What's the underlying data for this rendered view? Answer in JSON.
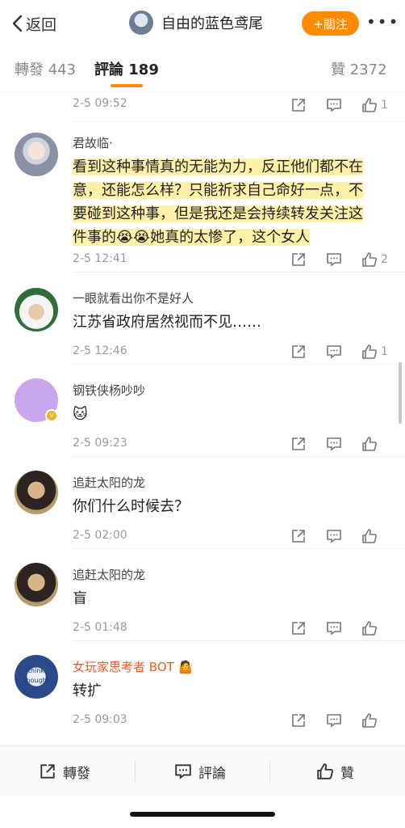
{
  "header": {
    "back_label": "返回",
    "title": "自由的蓝色鸢尾",
    "follow_label": "+關注",
    "more": "•••"
  },
  "tabs": {
    "repost_label": "轉發",
    "repost_count": "443",
    "comment_label": "評論",
    "comment_count": "189",
    "like_label": "贊",
    "like_count": "2372"
  },
  "comments": [
    {
      "time": "2-5 09:52",
      "likes": "1"
    },
    {
      "name": "君故临·",
      "lines": [
        "看到这种事情真的无能为力，反正他们都不在",
        "意，还能怎么样？只能祈求自己命好一点，不",
        "要碰到这种事，但是我还是会持续转发关注这"
      ],
      "line4_a": "件事的",
      "line4_emoji": "😭😭",
      "line4_b": "她真的太惨了，这个女人",
      "time": "2-5 12:41",
      "likes": "2"
    },
    {
      "name": "一眼就看出你不是好人",
      "text": "江苏省政府居然视而不见……",
      "time": "2-5 12:46",
      "likes": "1"
    },
    {
      "name": "钢铁侠杨吵吵",
      "text": "🐱",
      "time": "2-5 09:23",
      "likes": ""
    },
    {
      "name": "追赶太阳的龙",
      "text": "你们什么时候去？",
      "time": "2-5 02:00",
      "likes": ""
    },
    {
      "name": "追赶太阳的龙",
      "text": "盲",
      "time": "2-5 01:48",
      "likes": ""
    },
    {
      "name": "女玩家思考者 BOT",
      "name_emoji": "🤷",
      "avatar_text": "think thought",
      "text": "转扩",
      "time": "2-5 09:03",
      "likes": ""
    }
  ],
  "bottom": {
    "repost_label": "轉發",
    "comment_label": "評論",
    "like_label": "贊"
  },
  "colors": {
    "accent": "#ff8a00",
    "highlight": "#fff1a8",
    "bot_name": "#f05a24"
  }
}
